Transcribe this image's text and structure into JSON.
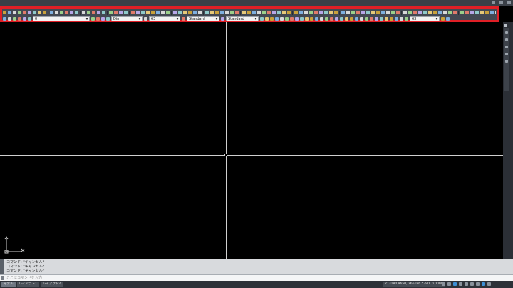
{
  "toolbar": {
    "layer_value": "0",
    "dimstyle_value": "Dim",
    "scale_value": "63",
    "textstyle_value": "Standard",
    "tablestyle_value": "Standard",
    "multileader_scale_value": "63"
  },
  "command": {
    "history": [
      "コマンド: *キャンセル*",
      "コマンド: *キャンセル*",
      "コマンド: *キャンセル*"
    ],
    "prompt_placeholder": "ここにコマンドを入力"
  },
  "statusbar": {
    "tabs": [
      "モデル",
      "レイアウト1",
      "レイアウト2"
    ],
    "coordinates": "213180.9650, 266186.5390, 0.0000"
  },
  "colors": {
    "highlight_border": "#e01f26",
    "canvas_background": "#000000",
    "toolbar_background": "#434852"
  },
  "icons": {
    "ucs": "ucs-icon",
    "close": "close-icon"
  }
}
